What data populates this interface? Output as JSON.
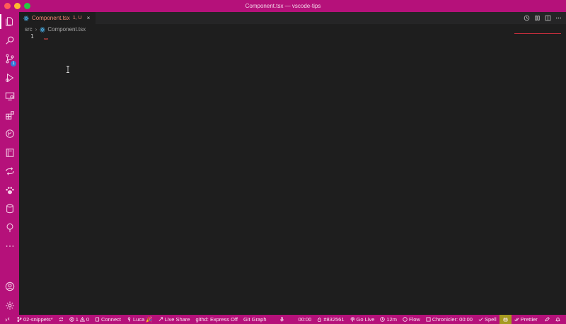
{
  "window": {
    "title": "Component.tsx — vscode-tips"
  },
  "activity": {
    "items": [
      {
        "name": "explorer-icon"
      },
      {
        "name": "search-icon"
      },
      {
        "name": "source-control-icon",
        "badge": "1"
      },
      {
        "name": "run-debug-icon"
      },
      {
        "name": "remote-explorer-icon"
      },
      {
        "name": "extensions-icon"
      },
      {
        "name": "github-icon"
      },
      {
        "name": "book-icon"
      },
      {
        "name": "live-share-icon"
      },
      {
        "name": "paw-icon"
      },
      {
        "name": "database-icon"
      },
      {
        "name": "tree-icon"
      },
      {
        "name": "more-icon"
      }
    ],
    "bottom": [
      {
        "name": "account-icon"
      },
      {
        "name": "settings-gear-icon"
      }
    ]
  },
  "tab": {
    "name": "Component.tsx",
    "status": "1, U",
    "close": "×"
  },
  "editor_actions": [
    "history-icon",
    "compare-icon",
    "split-icon",
    "more-actions-icon"
  ],
  "breadcrumb": {
    "folder": "src",
    "file": "Component.tsx"
  },
  "editor": {
    "line_numbers": [
      "1"
    ]
  },
  "status": {
    "branch": "02-snippets*",
    "errors": "1",
    "warnings": "0",
    "connect": "Connect",
    "user": "Luca 🎉",
    "live_share": "Live Share",
    "githd": "githd: Express Off",
    "git_graph": "Git Graph",
    "timer": "00:00",
    "issue": "#832561",
    "go_live": "Go Live",
    "wakatime": "12m",
    "flow": "Flow",
    "chronicler": "Chronicler: 00:00",
    "spell": "Spell",
    "prettier": "Prettier"
  },
  "colors": {
    "accent": "#b5117a",
    "editor_bg": "#1e1e1e",
    "error": "#f48771",
    "highlight": "#a59a1f"
  }
}
